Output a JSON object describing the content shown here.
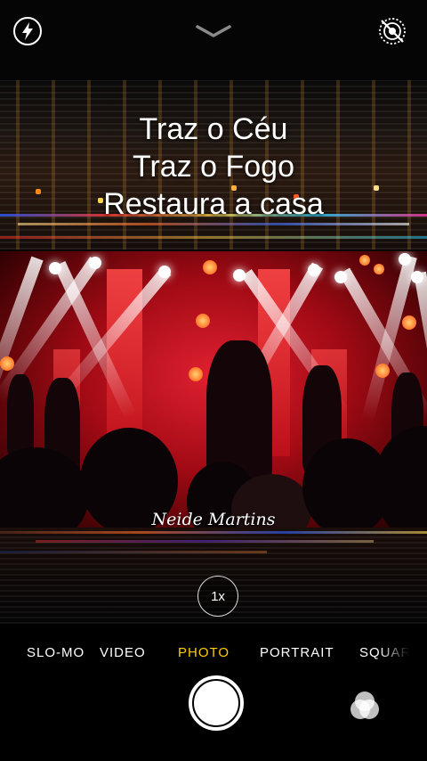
{
  "camera": {
    "flash_icon": "flash-icon",
    "live_photo_icon": "live-photo-off-icon",
    "chevron_icon": "chevron-down-icon",
    "zoom_label": "1x",
    "modes": [
      {
        "label": "SLO-MO",
        "active": false
      },
      {
        "label": "VIDEO",
        "active": false
      },
      {
        "label": "PHOTO",
        "active": true
      },
      {
        "label": "PORTRAIT",
        "active": false
      },
      {
        "label": "SQUARE",
        "active": false
      }
    ],
    "shutter_icon": "shutter-button",
    "filters_icon": "filters-icon",
    "accent_color": "#ffcc00"
  },
  "viewfinder": {
    "lyrics": [
      "Traz o Céu",
      "Traz o Fogo",
      "Restaura a casa"
    ],
    "caption": "Neide Martins"
  }
}
